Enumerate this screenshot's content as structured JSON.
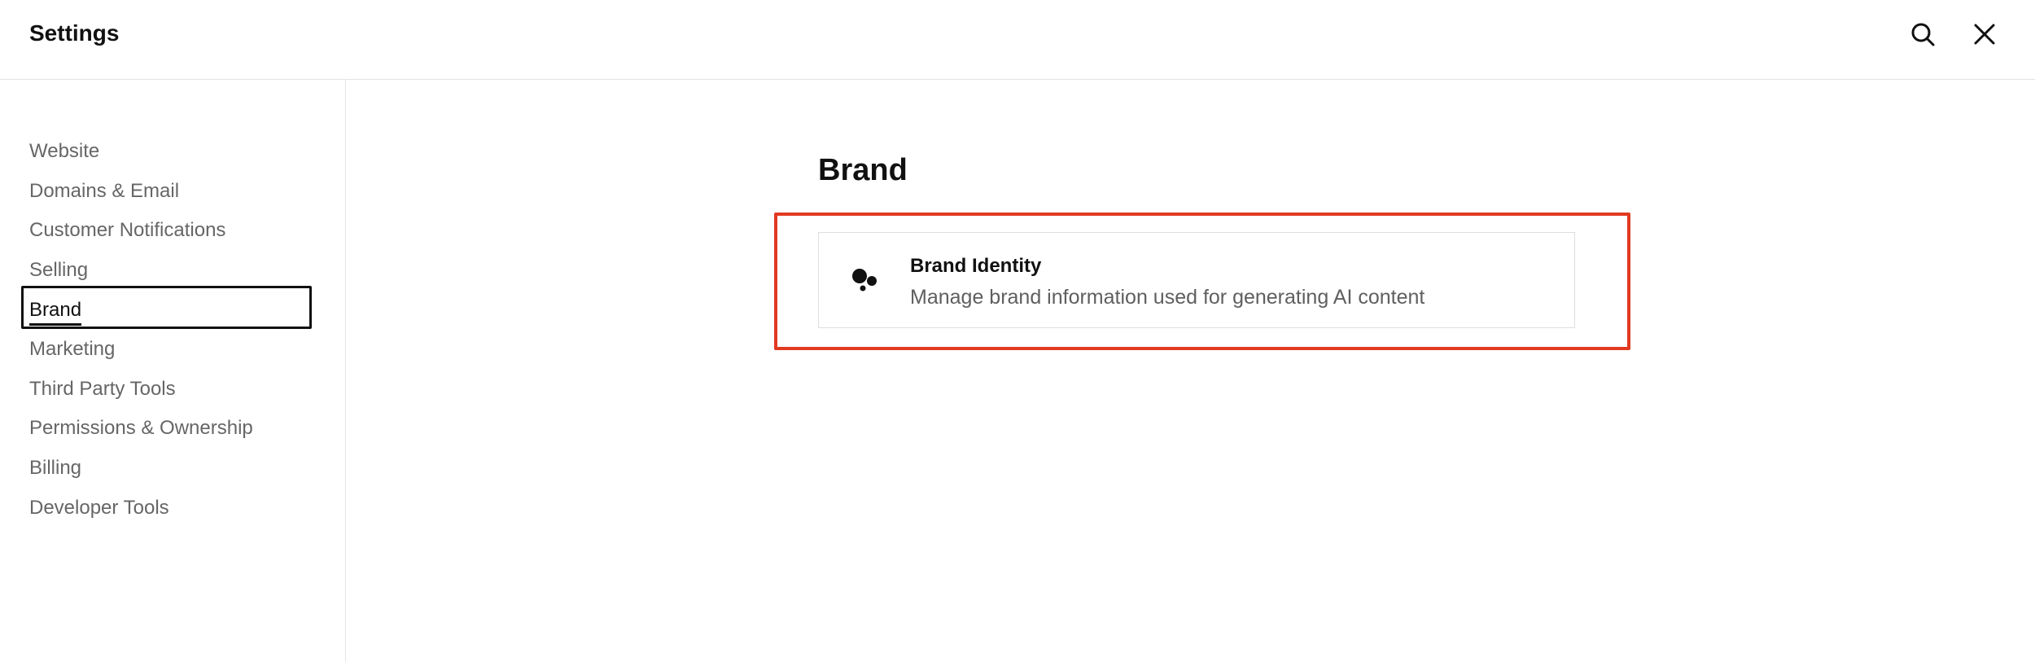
{
  "header": {
    "title": "Settings",
    "search_icon": "search-icon",
    "close_icon": "close-icon"
  },
  "sidebar": {
    "items": [
      {
        "label": "Website"
      },
      {
        "label": "Domains & Email"
      },
      {
        "label": "Customer Notifications"
      },
      {
        "label": "Selling"
      },
      {
        "label": "Brand",
        "active": true
      },
      {
        "label": "Marketing"
      },
      {
        "label": "Third Party Tools"
      },
      {
        "label": "Permissions & Ownership"
      },
      {
        "label": "Billing"
      },
      {
        "label": "Developer Tools"
      }
    ]
  },
  "main": {
    "title": "Brand",
    "cards": [
      {
        "title": "Brand Identity",
        "description": "Manage brand information used for generating AI content",
        "icon": "brand-identity-icon"
      }
    ]
  },
  "colors": {
    "highlight": "#e23a22",
    "text_primary": "#111111",
    "text_secondary": "#666666"
  }
}
